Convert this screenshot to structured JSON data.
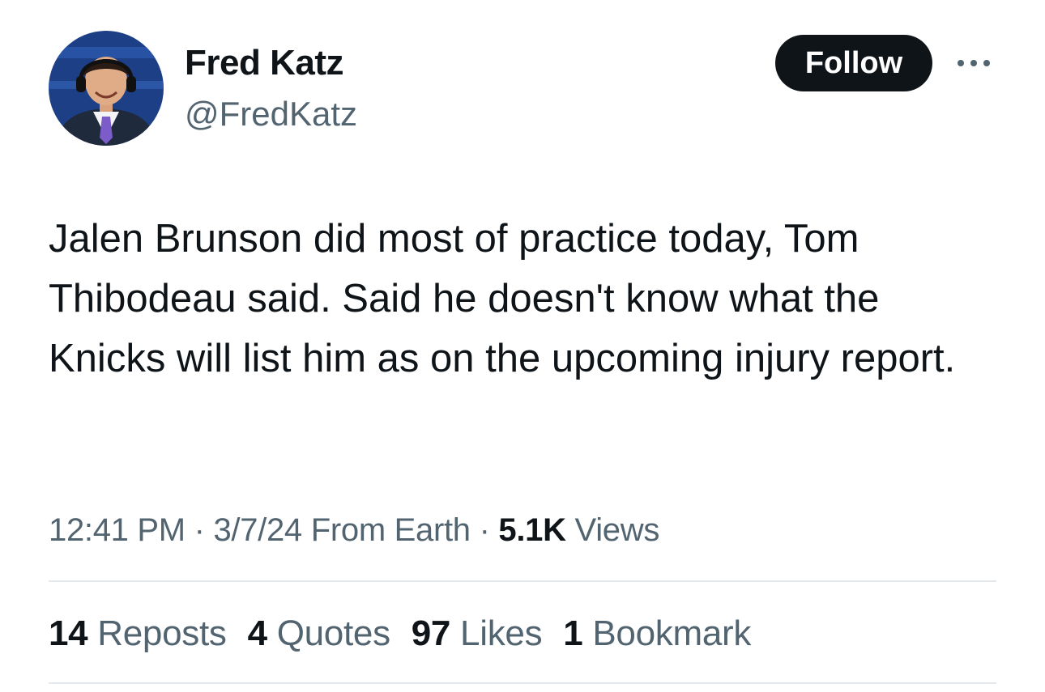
{
  "user": {
    "display_name": "Fred Katz",
    "handle": "@FredKatz"
  },
  "actions": {
    "follow_label": "Follow",
    "more_icon": "more-horizontal-icon"
  },
  "tweet": {
    "text": "Jalen Brunson did most of practice today, Tom Thibodeau said. Said he doesn't know what the Knicks will list him as on the upcoming injury report.",
    "time": "12:41 PM",
    "date": "3/7/24",
    "location": "From Earth",
    "views_count": "5.1K",
    "views_label": "Views"
  },
  "stats": {
    "reposts": {
      "count": "14",
      "label": "Reposts"
    },
    "quotes": {
      "count": "4",
      "label": "Quotes"
    },
    "likes": {
      "count": "97",
      "label": "Likes"
    },
    "bookmarks": {
      "count": "1",
      "label": "Bookmark"
    }
  },
  "colors": {
    "text_primary": "#0f1419",
    "text_secondary": "#536471",
    "follow_bg": "#0f1419",
    "divider": "#e6e9eb",
    "avatar_bg": "#1d3f86",
    "tie": "#7b5cc9"
  }
}
